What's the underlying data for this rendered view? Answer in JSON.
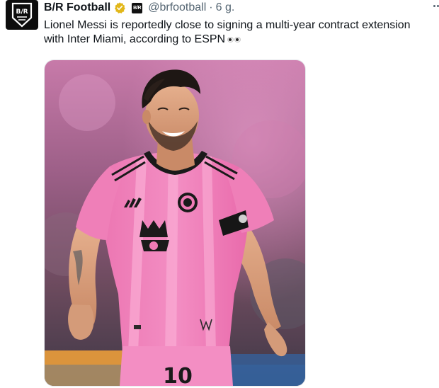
{
  "tweet": {
    "author_name": "B/R Football",
    "handle": "@brfootball",
    "separator": "·",
    "time": "6 g.",
    "affiliate_badge_text": "B/R",
    "text_line1": "Lionel Messi is reportedly close to signing a multi-year contract extension",
    "text_line2": "with Inter Miami, according to ESPN",
    "emoji": "eyes",
    "jersey_number": "10"
  },
  "icons": {
    "avatar": "br-football-logo",
    "verified": "verified-gold-badge-icon",
    "more": "more-options-icon"
  },
  "colors": {
    "verified_gold": "#e2b719",
    "jersey_pink": "#f07bb6",
    "avatar_bg": "#0d0d0d",
    "secondary_text": "#536471"
  }
}
